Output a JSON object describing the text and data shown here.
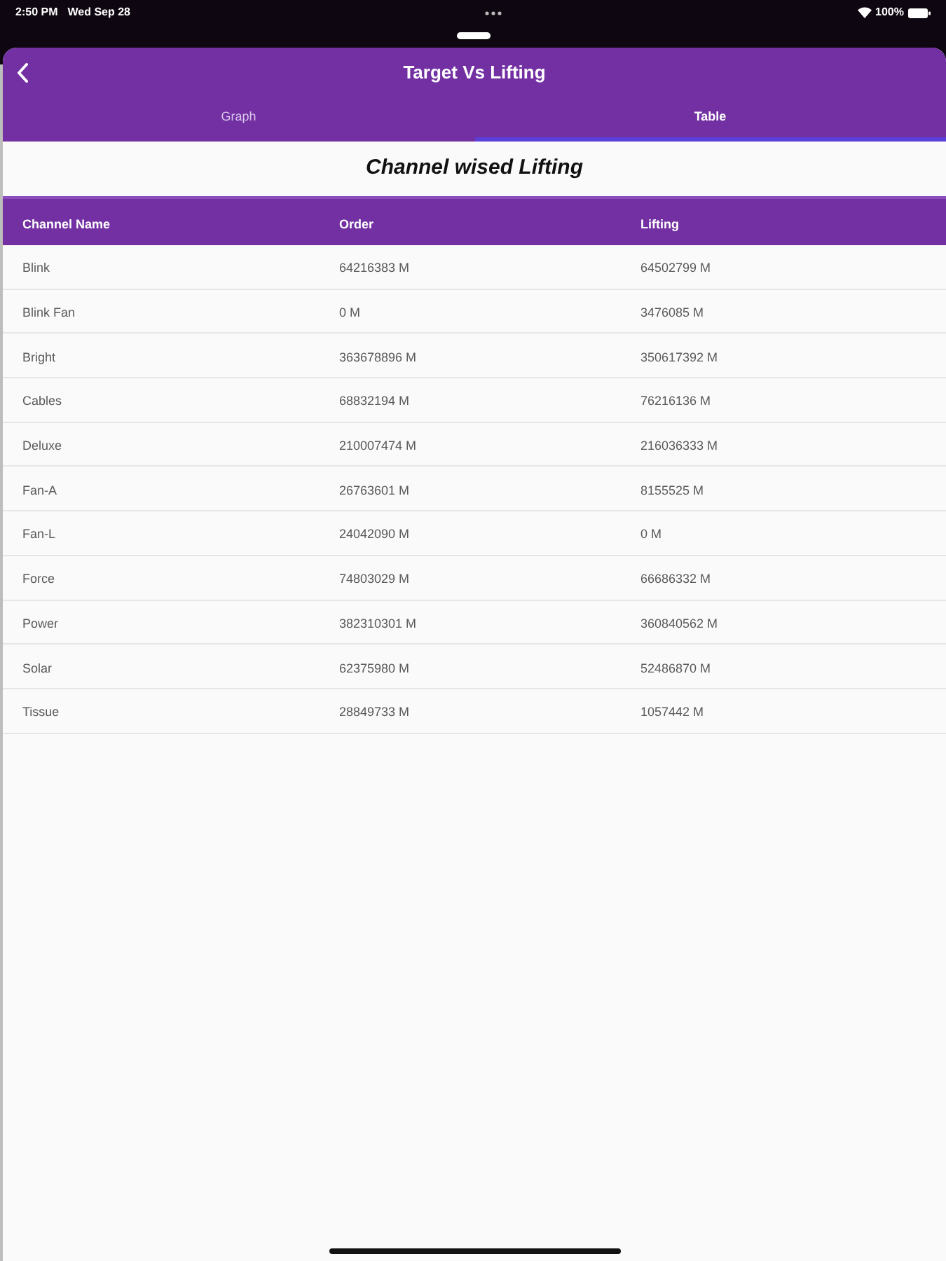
{
  "status_bar": {
    "time": "2:50 PM",
    "date": "Wed Sep 28",
    "battery_text": "100%"
  },
  "header": {
    "title": "Target Vs Lifting"
  },
  "tabs": [
    {
      "label": "Graph",
      "selected": false
    },
    {
      "label": "Table",
      "selected": true
    }
  ],
  "section_title": "Channel wised Lifting",
  "table": {
    "columns": [
      "Channel Name",
      "Order",
      "Lifting"
    ],
    "rows": [
      [
        "Blink",
        "64216383 M",
        "64502799 M"
      ],
      [
        "Blink Fan",
        "0 M",
        "3476085 M"
      ],
      [
        "Bright",
        "363678896 M",
        "350617392 M"
      ],
      [
        "Cables",
        "68832194 M",
        "76216136 M"
      ],
      [
        "Deluxe",
        "210007474 M",
        "216036333 M"
      ],
      [
        "Fan-A",
        "26763601 M",
        "8155525 M"
      ],
      [
        "Fan-L",
        "24042090 M",
        "0 M"
      ],
      [
        "Force",
        "74803029 M",
        "66686332 M"
      ],
      [
        "Power",
        "382310301 M",
        "360840562 M"
      ],
      [
        "Solar",
        "62375980 M",
        "52486870 M"
      ],
      [
        "Tissue",
        "28849733 M",
        "1057442 M"
      ]
    ]
  }
}
